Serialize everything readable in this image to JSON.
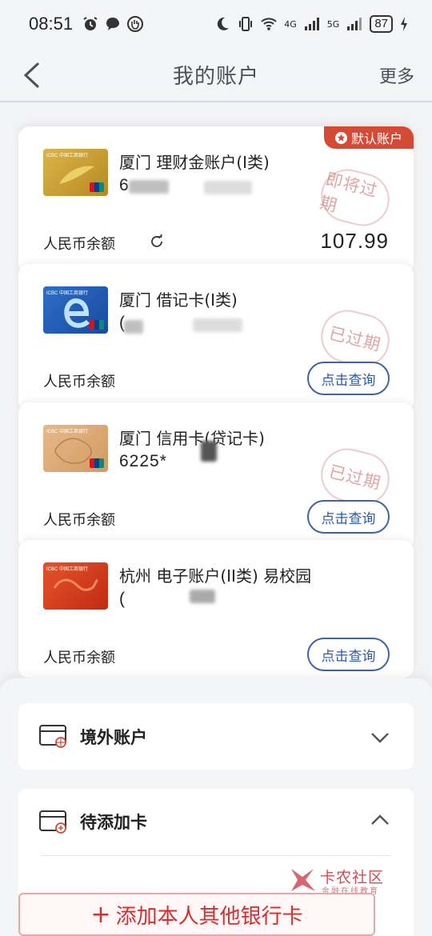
{
  "status_bar": {
    "time": "08:51",
    "network_4g": "4G",
    "network_5g": "5G",
    "battery": "87"
  },
  "nav": {
    "title": "我的账户",
    "more": "更多"
  },
  "accounts": [
    {
      "name": "厦门 理财金账户(I类)",
      "number": "6",
      "balance_label": "人民币余额",
      "balance": "107.99",
      "stamp": "即将过期",
      "badge": "默认账户",
      "thumb_brand": "ICBC 中国工商银行"
    },
    {
      "name": "厦门 借记卡(I类)",
      "number": "(",
      "balance_label": "人民币余额",
      "query": "点击查询",
      "stamp": "已过期",
      "thumb_brand": "ICBC 中国工商银行"
    },
    {
      "name": "厦门 信用卡(贷记卡)",
      "number": "6225*",
      "balance_label": "人民币余额",
      "query": "点击查询",
      "stamp": "已过期",
      "thumb_brand": "ICBC 中国工商银行"
    },
    {
      "name": "杭州 电子账户(II类) 易校园",
      "number": "(",
      "balance_label": "人民币余额",
      "query": "点击查询",
      "thumb_brand": "ICBC 中国工商银行"
    }
  ],
  "sections": {
    "overseas": "境外账户",
    "pending": "待添加卡"
  },
  "add_button": {
    "plus": "+",
    "label": "添加本人其他银行卡"
  },
  "watermark": {
    "title": "卡农社区",
    "subtitle": "金融在线教育"
  },
  "colors": {
    "accent_blue": "#2e5aa6",
    "red": "#d54a34",
    "stamp": "#c85a5a"
  }
}
